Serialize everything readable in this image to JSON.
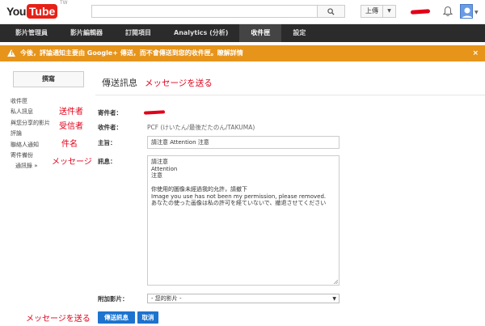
{
  "header": {
    "logo_you": "You",
    "logo_tube": "Tube",
    "logo_region": "TW",
    "upload_label": "上傳"
  },
  "nav": {
    "items": [
      {
        "label": "影片管理員",
        "active": false
      },
      {
        "label": "影片編輯器",
        "active": false
      },
      {
        "label": "訂閱項目",
        "active": false
      },
      {
        "label": "Analytics (分析)",
        "active": false
      },
      {
        "label": "收件匣",
        "active": true
      },
      {
        "label": "設定",
        "active": false
      }
    ]
  },
  "banner": {
    "text": "今後，評論通知主要由 Google+ 傳送，而不會傳送到您的收件匣。瞭解詳情",
    "close": "×"
  },
  "sidebar": {
    "compose_label": "撰寫",
    "items": [
      {
        "label": "收件匣"
      },
      {
        "label": "私人訊息"
      },
      {
        "label": "與您分享的影片"
      },
      {
        "label": "評論"
      },
      {
        "label": "聯絡人通知"
      },
      {
        "label": "寄件備份"
      },
      {
        "label": "通訊錄 »",
        "sub": true
      }
    ]
  },
  "main": {
    "title": "傳送訊息",
    "from_label": "寄件者：",
    "to_label": "收件者：",
    "to_value": "PCF (けいたん/最後だたのん/TAKUMA)",
    "subject_label": "主旨：",
    "subject_value": "請注意 Attention 注意",
    "message_label": "訊息：",
    "message_lines": [
      "請注意",
      "Attention",
      "注意",
      "",
      "你使用的圖像未經過我的允許，請撤下",
      "Image you use has not been my permission, please removed.",
      "あなたの使った画像は私の許可を経ていないで、撤退させてください"
    ],
    "attach_label": "附加影片：",
    "attach_value": "- 您的影片 -",
    "send_label": "傳送訊息",
    "cancel_label": "取消"
  },
  "annotations": {
    "title_note": "メッセージを送る",
    "sender": "送件者",
    "recipient": "受信者",
    "subject": "件名",
    "message": "メッセージ",
    "send_note": "メッセージを送る"
  },
  "colors": {
    "banner": "#e7941b",
    "nav_bg": "#2b2b2b",
    "button_blue": "#1d73ce",
    "annotation_red": "#e1001a"
  }
}
